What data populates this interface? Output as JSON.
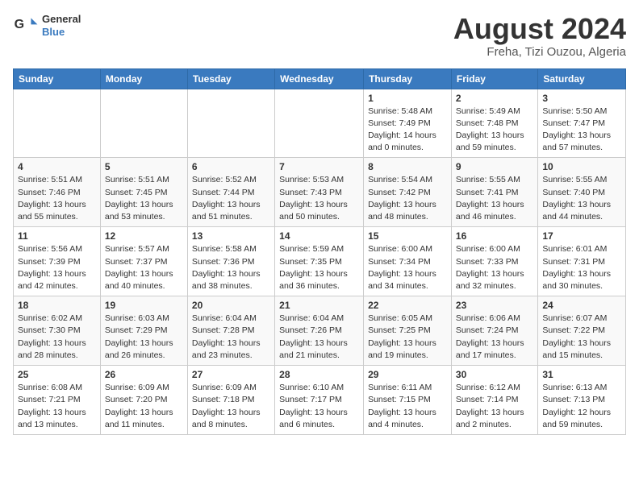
{
  "header": {
    "logo_line1": "General",
    "logo_line2": "Blue",
    "month_year": "August 2024",
    "location": "Freha, Tizi Ouzou, Algeria"
  },
  "days_of_week": [
    "Sunday",
    "Monday",
    "Tuesday",
    "Wednesday",
    "Thursday",
    "Friday",
    "Saturday"
  ],
  "weeks": [
    [
      {
        "day": "",
        "info": ""
      },
      {
        "day": "",
        "info": ""
      },
      {
        "day": "",
        "info": ""
      },
      {
        "day": "",
        "info": ""
      },
      {
        "day": "1",
        "info": "Sunrise: 5:48 AM\nSunset: 7:49 PM\nDaylight: 14 hours\nand 0 minutes."
      },
      {
        "day": "2",
        "info": "Sunrise: 5:49 AM\nSunset: 7:48 PM\nDaylight: 13 hours\nand 59 minutes."
      },
      {
        "day": "3",
        "info": "Sunrise: 5:50 AM\nSunset: 7:47 PM\nDaylight: 13 hours\nand 57 minutes."
      }
    ],
    [
      {
        "day": "4",
        "info": "Sunrise: 5:51 AM\nSunset: 7:46 PM\nDaylight: 13 hours\nand 55 minutes."
      },
      {
        "day": "5",
        "info": "Sunrise: 5:51 AM\nSunset: 7:45 PM\nDaylight: 13 hours\nand 53 minutes."
      },
      {
        "day": "6",
        "info": "Sunrise: 5:52 AM\nSunset: 7:44 PM\nDaylight: 13 hours\nand 51 minutes."
      },
      {
        "day": "7",
        "info": "Sunrise: 5:53 AM\nSunset: 7:43 PM\nDaylight: 13 hours\nand 50 minutes."
      },
      {
        "day": "8",
        "info": "Sunrise: 5:54 AM\nSunset: 7:42 PM\nDaylight: 13 hours\nand 48 minutes."
      },
      {
        "day": "9",
        "info": "Sunrise: 5:55 AM\nSunset: 7:41 PM\nDaylight: 13 hours\nand 46 minutes."
      },
      {
        "day": "10",
        "info": "Sunrise: 5:55 AM\nSunset: 7:40 PM\nDaylight: 13 hours\nand 44 minutes."
      }
    ],
    [
      {
        "day": "11",
        "info": "Sunrise: 5:56 AM\nSunset: 7:39 PM\nDaylight: 13 hours\nand 42 minutes."
      },
      {
        "day": "12",
        "info": "Sunrise: 5:57 AM\nSunset: 7:37 PM\nDaylight: 13 hours\nand 40 minutes."
      },
      {
        "day": "13",
        "info": "Sunrise: 5:58 AM\nSunset: 7:36 PM\nDaylight: 13 hours\nand 38 minutes."
      },
      {
        "day": "14",
        "info": "Sunrise: 5:59 AM\nSunset: 7:35 PM\nDaylight: 13 hours\nand 36 minutes."
      },
      {
        "day": "15",
        "info": "Sunrise: 6:00 AM\nSunset: 7:34 PM\nDaylight: 13 hours\nand 34 minutes."
      },
      {
        "day": "16",
        "info": "Sunrise: 6:00 AM\nSunset: 7:33 PM\nDaylight: 13 hours\nand 32 minutes."
      },
      {
        "day": "17",
        "info": "Sunrise: 6:01 AM\nSunset: 7:31 PM\nDaylight: 13 hours\nand 30 minutes."
      }
    ],
    [
      {
        "day": "18",
        "info": "Sunrise: 6:02 AM\nSunset: 7:30 PM\nDaylight: 13 hours\nand 28 minutes."
      },
      {
        "day": "19",
        "info": "Sunrise: 6:03 AM\nSunset: 7:29 PM\nDaylight: 13 hours\nand 26 minutes."
      },
      {
        "day": "20",
        "info": "Sunrise: 6:04 AM\nSunset: 7:28 PM\nDaylight: 13 hours\nand 23 minutes."
      },
      {
        "day": "21",
        "info": "Sunrise: 6:04 AM\nSunset: 7:26 PM\nDaylight: 13 hours\nand 21 minutes."
      },
      {
        "day": "22",
        "info": "Sunrise: 6:05 AM\nSunset: 7:25 PM\nDaylight: 13 hours\nand 19 minutes."
      },
      {
        "day": "23",
        "info": "Sunrise: 6:06 AM\nSunset: 7:24 PM\nDaylight: 13 hours\nand 17 minutes."
      },
      {
        "day": "24",
        "info": "Sunrise: 6:07 AM\nSunset: 7:22 PM\nDaylight: 13 hours\nand 15 minutes."
      }
    ],
    [
      {
        "day": "25",
        "info": "Sunrise: 6:08 AM\nSunset: 7:21 PM\nDaylight: 13 hours\nand 13 minutes."
      },
      {
        "day": "26",
        "info": "Sunrise: 6:09 AM\nSunset: 7:20 PM\nDaylight: 13 hours\nand 11 minutes."
      },
      {
        "day": "27",
        "info": "Sunrise: 6:09 AM\nSunset: 7:18 PM\nDaylight: 13 hours\nand 8 minutes."
      },
      {
        "day": "28",
        "info": "Sunrise: 6:10 AM\nSunset: 7:17 PM\nDaylight: 13 hours\nand 6 minutes."
      },
      {
        "day": "29",
        "info": "Sunrise: 6:11 AM\nSunset: 7:15 PM\nDaylight: 13 hours\nand 4 minutes."
      },
      {
        "day": "30",
        "info": "Sunrise: 6:12 AM\nSunset: 7:14 PM\nDaylight: 13 hours\nand 2 minutes."
      },
      {
        "day": "31",
        "info": "Sunrise: 6:13 AM\nSunset: 7:13 PM\nDaylight: 12 hours\nand 59 minutes."
      }
    ]
  ]
}
